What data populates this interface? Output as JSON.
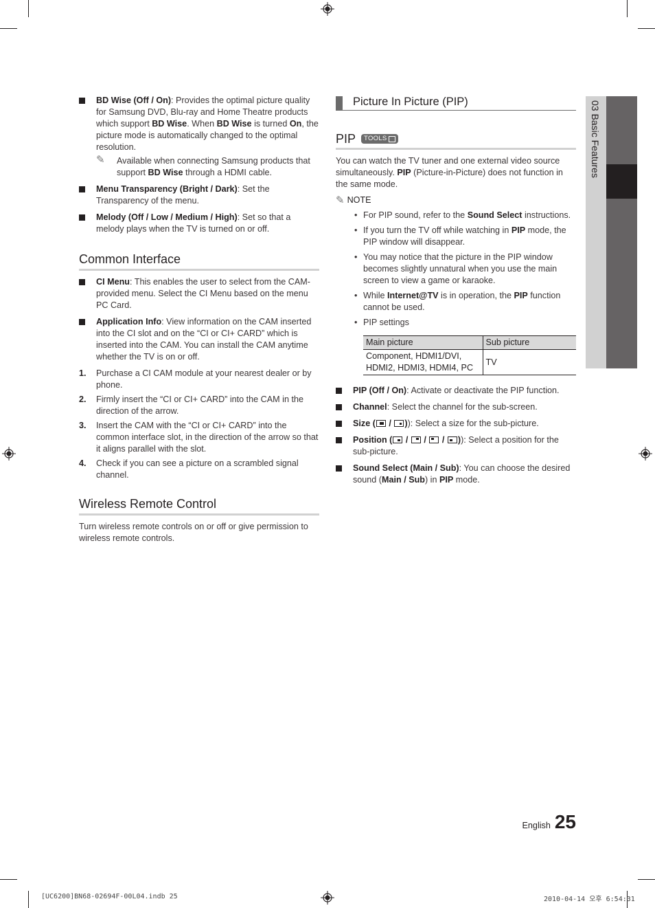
{
  "left_column": {
    "settings_items": [
      {
        "bold": "BD Wise (Off / On)",
        "text": ": Provides the optimal picture quality for Samsung DVD, Blu-ray and Home Theatre products which support ",
        "bold2": "BD Wise",
        "text2": ". When ",
        "bold3": "BD Wise",
        "text3": " is turned ",
        "bold4": "On",
        "text4": ", the picture mode is automatically changed to the optimal resolution."
      },
      {
        "bold": "Menu Transparency (Bright / Dark)",
        "text": ": Set the Transparency of the menu."
      },
      {
        "bold": "Melody (Off / Low / Medium / High)",
        "text": ": Set so that a melody plays when the TV is turned on or off."
      }
    ],
    "bd_wise_note": {
      "text": "Available when connecting Samsung products that support ",
      "bold": "BD Wise",
      "text2": " through a HDMI cable."
    },
    "common_interface": {
      "title": "Common Interface",
      "items": [
        {
          "bold": "CI Menu",
          "text": ": This enables the user to select from the CAM-provided menu. Select the CI Menu based on the menu PC Card."
        },
        {
          "bold": "Application Info",
          "text": ": View information on the CAM inserted into the CI slot and on the “CI or CI+ CARD” which is inserted into the CAM. You can install the CAM anytime whether the TV is on or off."
        }
      ],
      "steps": [
        {
          "num": "1.",
          "text": "Purchase a CI CAM module at your nearest dealer or by phone."
        },
        {
          "num": "2.",
          "text": "Firmly insert the “CI or CI+ CARD” into the CAM in the direction of the arrow."
        },
        {
          "num": "3.",
          "text": "Insert the CAM with the “CI or CI+ CARD” into the common interface slot, in the direction of the arrow so that it aligns parallel with the slot."
        },
        {
          "num": "4.",
          "text": "Check if you can see a picture on a scrambled signal channel."
        }
      ]
    },
    "wireless": {
      "title": "Wireless Remote Control",
      "body": "Turn wireless remote controls on or off or give permission to wireless remote controls."
    }
  },
  "right_column": {
    "band_title": "Picture In Picture (PIP)",
    "pip_title": "PIP",
    "tools_badge": "TOOLS",
    "intro": {
      "text": "You can watch the TV tuner and one external video source simultaneously. ",
      "bold": "PIP",
      "text2": " (Picture-in-Picture) does not function in the same mode."
    },
    "note_label": "NOTE",
    "notes": [
      {
        "text": "For PIP sound, refer to the ",
        "bold": "Sound Select",
        "text2": " instructions."
      },
      {
        "text": "If you turn the TV off while watching in ",
        "bold": "PIP",
        "text2": " mode, the PIP window will disappear."
      },
      {
        "text": "You may notice that the picture in the PIP window becomes slightly unnatural when you use the main screen to view a game or karaoke.",
        "bold": "",
        "text2": ""
      },
      {
        "text": "While ",
        "bold": "Internet@TV",
        "text2": " is in operation, the ",
        "bold2": "PIP",
        "text3": " function cannot be used."
      },
      {
        "text": "PIP settings",
        "bold": "",
        "text2": ""
      }
    ],
    "table": {
      "headers": [
        "Main picture",
        "Sub picture"
      ],
      "rows": [
        [
          "Component, HDMI1/DVI, HDMI2, HDMI3, HDMI4, PC",
          "TV"
        ]
      ]
    },
    "items": [
      {
        "bold": "PIP (Off / On)",
        "text": ": Activate or deactivate the PIP function."
      },
      {
        "bold": "Channel",
        "text": ": Select the channel for the sub-screen."
      },
      {
        "bold": "Size (",
        "text": "): Select a size for the sub-picture.",
        "icons": [
          "size-large-icon",
          "size-small-icon"
        ]
      },
      {
        "bold": "Position (",
        "text": "): Select a position for the sub-picture.",
        "icons": [
          "pos-bottom-right-icon",
          "pos-top-right-icon",
          "pos-top-left-icon",
          "pos-bottom-left-icon"
        ]
      },
      {
        "bold": "Sound Select (Main / Sub)",
        "text": ": You can choose the desired sound (",
        "bold2": "Main / Sub",
        "text2": ") in ",
        "bold3": "PIP",
        "text3": " mode."
      }
    ]
  },
  "side_tab": {
    "label": "03   Basic Features"
  },
  "footer": {
    "language": "English",
    "page_number": "25"
  },
  "slug": {
    "file": "[UC6200]BN68-02694F-00L04.indb   25",
    "timestamp": "2010-04-14   오후 6:54:31"
  }
}
